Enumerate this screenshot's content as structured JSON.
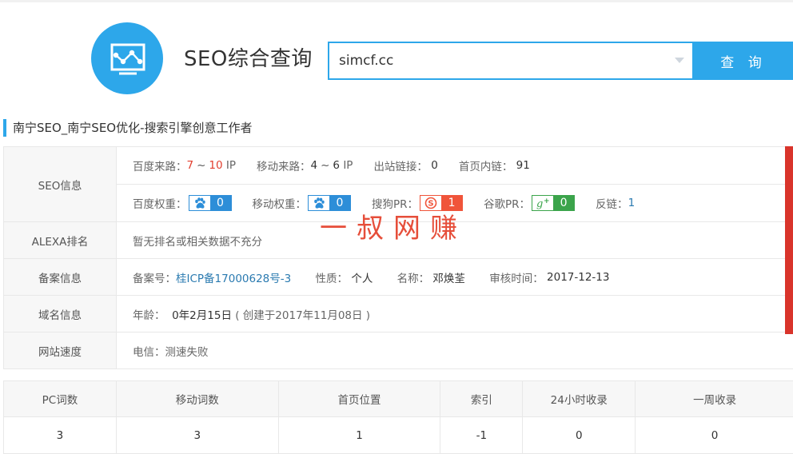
{
  "header": {
    "app_title": "SEO综合查询",
    "search_value": "simcf.cc",
    "query_button": "查 询"
  },
  "site_title": "南宁SEO_南宁SEO优化-搜索引擎创意工作者",
  "seo_info": {
    "label": "SEO信息",
    "baidu_source": {
      "label": "百度来路：",
      "low": "7",
      "high": "10",
      "unit": "IP"
    },
    "mobile_source": {
      "label": "移动来路：",
      "low": "4",
      "high": "6",
      "unit": "IP"
    },
    "outbound_links": {
      "label": "出站链接：",
      "value": "0"
    },
    "home_internal_links": {
      "label": "首页内链：",
      "value": "91"
    },
    "baidu_weight": {
      "label": "百度权重：",
      "value": "0"
    },
    "mobile_weight": {
      "label": "移动权重：",
      "value": "0"
    },
    "sogou_pr": {
      "label": "搜狗PR：",
      "value": "1"
    },
    "google_pr": {
      "label": "谷歌PR：",
      "value": "0"
    },
    "backlinks": {
      "label": "反链：",
      "value": "1"
    }
  },
  "alexa": {
    "label": "ALEXA排名",
    "value": "暂无排名或相关数据不充分"
  },
  "icp": {
    "label": "备案信息",
    "number_label": "备案号：",
    "number": "桂ICP备17000628号-3",
    "nature_label": "性质：",
    "nature": "个人",
    "name_label": "名称：",
    "name": "邓焕荃",
    "audit_label": "审核时间：",
    "audit_date": "2017-12-13"
  },
  "domain": {
    "label": "域名信息",
    "age_label": "年龄：",
    "age": "0年2月15日",
    "created": "( 创建于2017年11月08日 )"
  },
  "speed": {
    "label": "网站速度",
    "value": "电信：测速失败"
  },
  "stats": {
    "headers": [
      "PC词数",
      "移动词数",
      "首页位置",
      "索引",
      "24小时收录",
      "一周收录"
    ],
    "values": [
      "3",
      "3",
      "1",
      "-1",
      "0",
      "0"
    ]
  },
  "watermark": "一叔网赚",
  "colors": {
    "accent": "#2da7ea",
    "red": "#e23e2e",
    "badge_blue": "#2d8ed8",
    "badge_orange": "#f0543a",
    "badge_green": "#3ba44b"
  },
  "icons": [
    "monitor-chart-icon",
    "dropdown-caret-icon",
    "baidu-paw-icon",
    "sogou-icon",
    "google-plus-icon"
  ]
}
